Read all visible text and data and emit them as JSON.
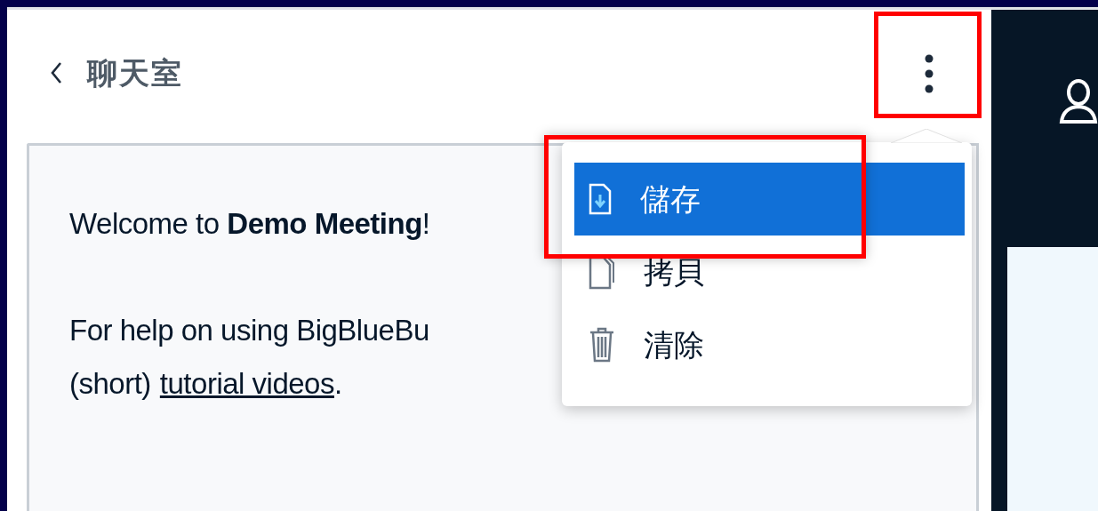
{
  "chat_panel": {
    "title": "聊天室",
    "welcome": {
      "line_1": "Welcome to **Demo Meeting**!",
      "line_2": "For help on using BigBlueBu",
      "line_3_before": "(short)",
      "line_3_link": "tutorial videos",
      "line_3_after": "."
    }
  },
  "options_menu": {
    "items": [
      {
        "kind": "save",
        "label": "儲存",
        "selected": true
      },
      {
        "kind": "copy",
        "label": "拷貝",
        "selected": false
      },
      {
        "kind": "clear",
        "label": "清除",
        "selected": false
      }
    ]
  }
}
